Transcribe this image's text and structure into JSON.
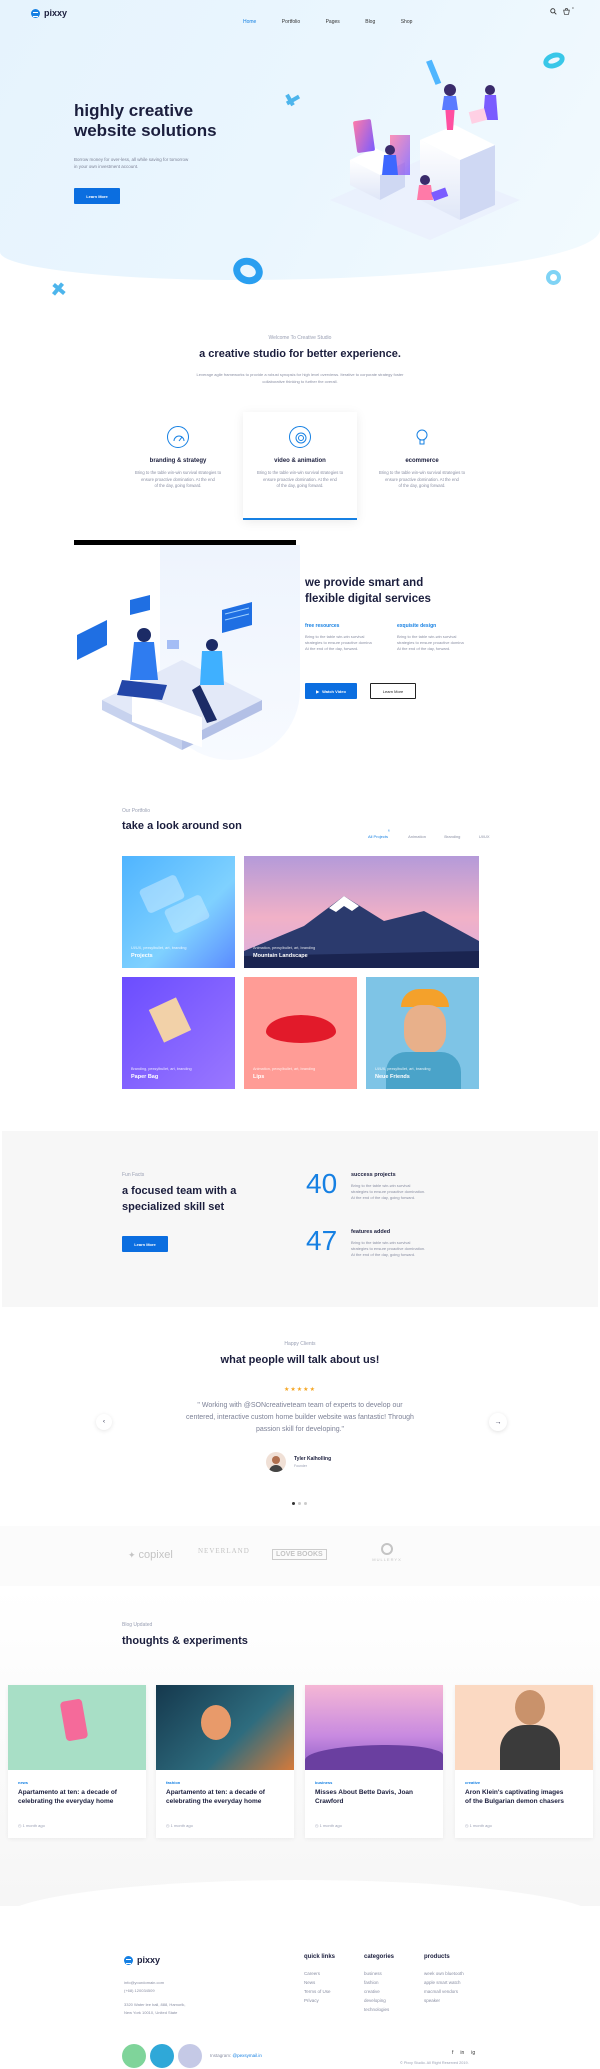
{
  "header": {
    "logo": "pixxy",
    "nav": [
      "Home",
      "Portfolio",
      "Pages",
      "Blog",
      "Shop"
    ],
    "cart_count": "0"
  },
  "hero": {
    "title_line1": "highly creative",
    "title_line2": "website solutions",
    "subtitle_line1": "Borrow money for over-less, all while saving for tomorrow",
    "subtitle_line2": "in your own investment account.",
    "cta": "Learn More"
  },
  "studio": {
    "kicker": "Welcome To Creative Studio",
    "title": "a creative studio for better experience.",
    "desc_line1": "Leverage agile frameworks to provide a robust synopsis for high level overviews. Iterative to corporate strategy foster",
    "desc_line2": "collaborative thinking to further the overall.",
    "features": [
      {
        "icon": "gauge-icon",
        "title": "branding & strategy",
        "desc": [
          "Bring to the table win-win survival strategies to",
          "ensure proactive domination. At the end",
          "of the day, going forward."
        ]
      },
      {
        "icon": "lifebuoy-icon",
        "title": "video & animation",
        "desc": [
          "Bring to the table win-win survival strategies to",
          "ensure proactive domination. At the end",
          "of the day, going forward."
        ]
      },
      {
        "icon": "lightbulb-icon",
        "title": "ecommerce",
        "desc": [
          "Bring to the table win-win survival strategies to",
          "ensure proactive domination. At the end",
          "of the day, going forward."
        ]
      }
    ]
  },
  "services": {
    "title_line1": "we provide smart and",
    "title_line2": "flexible digital services",
    "col1_title": "free resources",
    "col1_desc": [
      "Bring to the table win-win survival",
      "strategies to ensure proactive domina",
      "At the end of the day, forward."
    ],
    "col2_title": "exquisite design",
    "col2_desc": [
      "Bring to the table win-win survival",
      "strategies to ensure proactive domina",
      "At the end of the day, forward."
    ],
    "btn_video": "Watch Video",
    "btn_learn": "Learn More"
  },
  "portfolio": {
    "kicker": "Our Portfolio",
    "title": "take a look around son",
    "filters": [
      "All Projects",
      "Animation",
      "Branding",
      "UI/UX"
    ],
    "filter_count": "6",
    "items": [
      {
        "tags": "UI/UX, pexsylbullet, art, branding",
        "name": "Projects"
      },
      {
        "tags": "Animation, pexsylbullet, art, branding",
        "name": "Mountain Landscape"
      },
      {
        "tags": "Branding, pexsylbullet, art, branding",
        "name": "Paper Bag"
      },
      {
        "tags": "Animation, pexsylbullet, art, branding",
        "name": "Lips"
      },
      {
        "tags": "UI/UX, pexsylbullet, art, branding",
        "name": "Neue Friends"
      }
    ]
  },
  "facts": {
    "kicker": "Fun Facts",
    "title_line1": "a focused team with a",
    "title_line2": "specialized skill set",
    "cta": "Learn More",
    "items": [
      {
        "number": "40",
        "label": "success projects",
        "desc": [
          "Bring to the table win-win survival",
          "strategies to ensure proactive domination.",
          "At the end of the day, going forward."
        ]
      },
      {
        "number": "47",
        "label": "features added",
        "desc": [
          "Bring to the table win-win survival",
          "strategies to ensure proactive domination.",
          "At the end of the day, going forward."
        ]
      }
    ]
  },
  "testimonials": {
    "kicker": "Happy Clients",
    "title": "what people will talk about us!",
    "stars": "★★★★★",
    "quote_line1": "\" Working with @SONcreativeteam team of experts to develop our",
    "quote_line2": "centered, interactive custom home builder website was fantastic! Through",
    "quote_line3": "passion skill for developing.\"",
    "author": "Tyler Kalholling",
    "role": "Founder"
  },
  "brands": [
    "copixel",
    "NEVERLAND",
    "LOVE BOOKS",
    "MULLERYX"
  ],
  "blog": {
    "kicker": "Blog Updated",
    "title": "thoughts & experiments",
    "posts": [
      {
        "category": "news",
        "title_line1": "Apartamento at ten: a decade of",
        "title_line2": "celebrating the everyday home",
        "date": "1 month ago"
      },
      {
        "category": "fashion",
        "title_line1": "Apartamento at ten: a decade of",
        "title_line2": "celebrating the everyday home",
        "date": "1 month ago"
      },
      {
        "category": "business",
        "title_line1": "Misses About Bette Davis, Joan",
        "title_line2": "Crawford",
        "date": "1 month ago"
      },
      {
        "category": "creative",
        "title_line1": "Aron Klein's captivating images",
        "title_line2": "of the Bulgarian demon chasers",
        "date": "1 month ago"
      }
    ]
  },
  "footer": {
    "logo": "pixxy",
    "email": "info@yourdomain.com",
    "phone": "(+68) 120034509",
    "address_line1": "3320 Water lee ball, 888, Hamorik,",
    "address_line2": "New York 10010, United State",
    "quick_links": {
      "title": "quick links",
      "items": [
        "Careers",
        "News",
        "Terms of Use",
        "Privacy"
      ]
    },
    "categories": {
      "title": "categories",
      "items": [
        "business",
        "fashion",
        "creative",
        "developing",
        "technologies"
      ]
    },
    "products": {
      "title": "products",
      "items": [
        "week own bluetooth",
        "apple smart watch",
        "macmall vendors",
        "speaker"
      ]
    },
    "instagram_label": "Instagram:",
    "instagram_handle": "@pexsymail.in",
    "copyright": "© Pixxy Studio. All Right Reserved 2019.",
    "social": [
      "f",
      "in",
      "ig"
    ]
  },
  "colors": {
    "accent": "#0b6ee0",
    "dark": "#1b1e3d"
  }
}
